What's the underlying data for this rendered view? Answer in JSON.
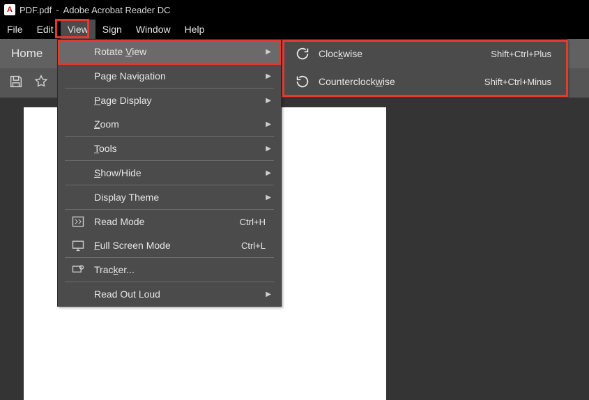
{
  "title": {
    "filename": "PDF.pdf",
    "dash": "-",
    "app": "Adobe Acrobat Reader DC"
  },
  "menubar": {
    "file": "File",
    "edit": "Edit",
    "view": "View",
    "sign": "Sign",
    "window": "Window",
    "help": "Help"
  },
  "toolbar": {
    "home": "Home"
  },
  "view_menu": {
    "rotate_view": "Rotate View",
    "page_navigation": "Page Navigation",
    "page_display": "Page Display",
    "zoom": "Zoom",
    "tools": "Tools",
    "show_hide": "Show/Hide",
    "display_theme": "Display Theme",
    "read_mode": "Read Mode",
    "read_mode_shortcut": "Ctrl+H",
    "full_screen": "Full Screen Mode",
    "full_screen_shortcut": "Ctrl+L",
    "tracker": "Tracker...",
    "read_out_loud": "Read Out Loud"
  },
  "rotate_submenu": {
    "clockwise": "Clockwise",
    "clockwise_shortcut": "Shift+Ctrl+Plus",
    "counterclockwise": "Counterclockwise",
    "counterclockwise_shortcut": "Shift+Ctrl+Minus"
  },
  "ul": {
    "V": "V",
    "P": "P",
    "Z": "Z",
    "T": "T",
    "S": "S",
    "F": "F",
    "k": "k",
    "w": "w"
  }
}
